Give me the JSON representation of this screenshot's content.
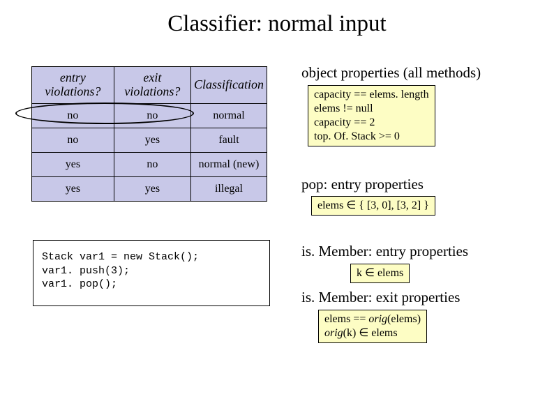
{
  "title": "Classifier: normal input",
  "table": {
    "headers": {
      "entry": "entry violations?",
      "exit": "exit violations?",
      "cls": "Classification"
    },
    "rows": [
      {
        "entry": "no",
        "exit": "no",
        "cls": "normal"
      },
      {
        "entry": "no",
        "exit": "yes",
        "cls": "fault"
      },
      {
        "entry": "yes",
        "exit": "no",
        "cls": "normal (new)"
      },
      {
        "entry": "yes",
        "exit": "yes",
        "cls": "illegal"
      }
    ]
  },
  "code": "Stack var1 = new Stack();\nvar1. push(3);\nvar1. pop();",
  "right": {
    "objprops_header": "object properties (all methods)",
    "objprops": [
      "capacity == elems. length",
      "elems != null",
      "capacity == 2",
      "top. Of. Stack >= 0"
    ],
    "pop_header": "pop: entry properties",
    "pop_line": "elems ∈ { [3, 0], [3, 2] }",
    "ismember_entry_header": "is. Member: entry properties",
    "ismember_entry_line": "k ∈ elems",
    "ismember_exit_header": "is. Member: exit properties",
    "ismember_exit_l1a": "elems == ",
    "ismember_exit_l1b": "orig",
    "ismember_exit_l1c": "(elems)",
    "ismember_exit_l2a": "orig",
    "ismember_exit_l2b": "(k) ∈ elems"
  }
}
